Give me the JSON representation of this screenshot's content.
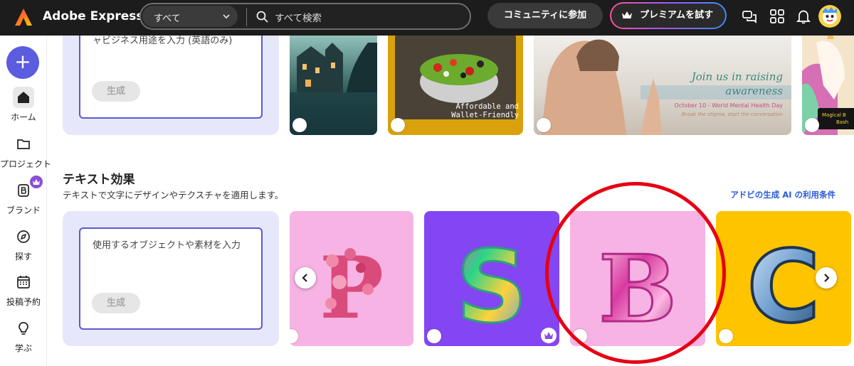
{
  "topbar": {
    "app_name": "Adobe Express",
    "scope_label": "すべて",
    "search_placeholder": "すべて検索",
    "community_label": "コミュニティに参加",
    "premium_label": "プレミアムを試す",
    "icons": [
      "share-icon",
      "apps-grid-icon",
      "bell-icon",
      "avatar"
    ]
  },
  "rail": {
    "create_label": "+",
    "items": [
      {
        "label": "ホーム",
        "icon": "home-icon"
      },
      {
        "label": "プロジェクト",
        "icon": "folder-icon"
      },
      {
        "label": "ブランド",
        "icon": "brand-icon"
      },
      {
        "label": "探す",
        "icon": "compass-icon"
      },
      {
        "label": "投稿予約",
        "icon": "calendar-icon"
      },
      {
        "label": "学ぶ",
        "icon": "lightbulb-icon"
      }
    ]
  },
  "top_row": {
    "prompt_text": "ャビジネス用途を入力 (英語のみ)",
    "generate_label": "生成",
    "salad_caption_line1": "Affordable and",
    "salad_caption_line2": "Wallet-Friendly",
    "yoga_headline_line1": "Join us in raising",
    "yoga_headline_line2": "awareness",
    "yoga_date": "October 10 - World Mental Health Day",
    "yoga_sub": "Break the stigma, start the conversation",
    "unicorn_caption_line1": "Magical B",
    "unicorn_caption_line2": "Bash"
  },
  "text_effects": {
    "title": "テキスト効果",
    "description": "テキストで文字にデザインやテクスチャを適用します。",
    "terms_link": "アドビの生成 AI の利用条件",
    "prompt_text": "使用するオブジェクトや素材を入力",
    "generate_label": "生成",
    "cards": [
      {
        "letter": "P",
        "style": "pink flowers",
        "bg": "#f6b3e3"
      },
      {
        "letter": "S",
        "style": "rainbow knit",
        "bg": "#8446f2"
      },
      {
        "letter": "B",
        "style": "pink balloon",
        "bg": "#f6b3e3"
      },
      {
        "letter": "C",
        "style": "blue puffer",
        "bg": "#ffc400"
      }
    ]
  },
  "colors": {
    "accent": "#5c5ce0",
    "highlight": "#e60012",
    "link": "#2a5ad8"
  }
}
